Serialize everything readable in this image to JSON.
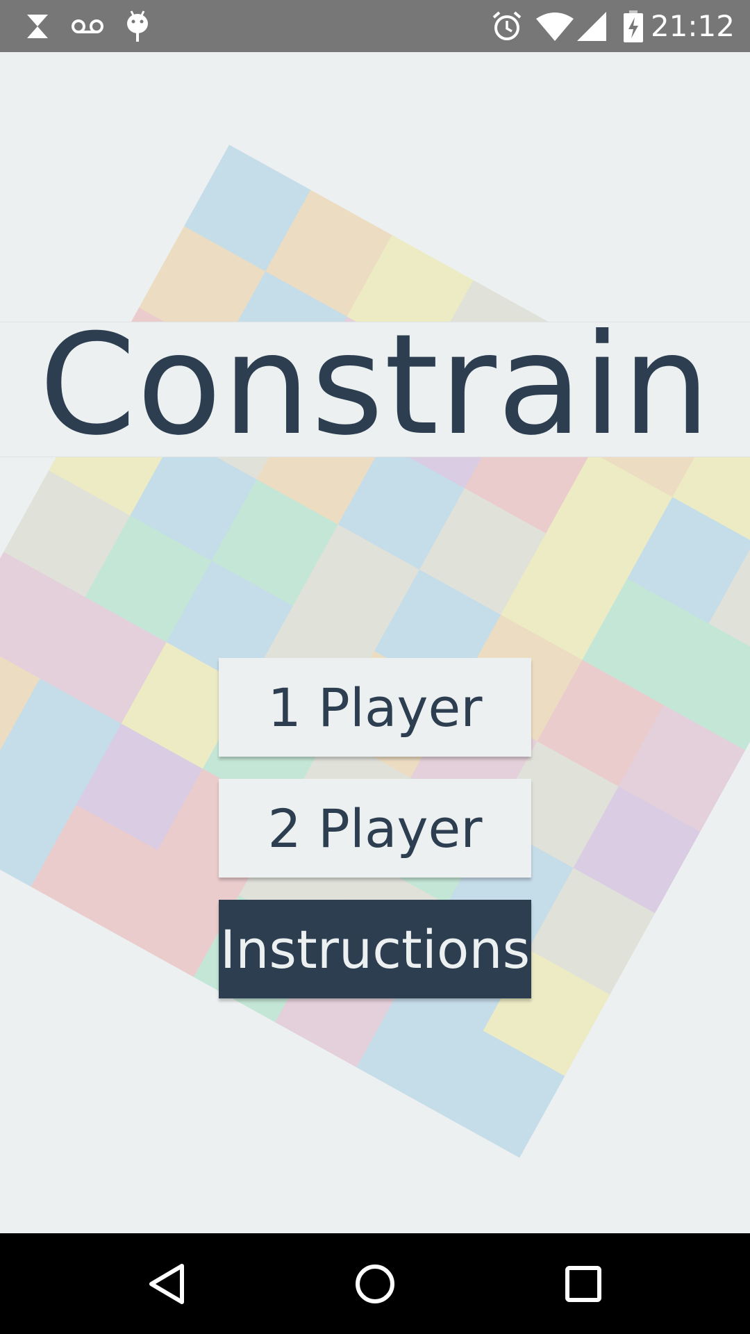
{
  "status_bar": {
    "time": "21:12",
    "left_icons": [
      "hourglass-icon",
      "voicemail-icon",
      "android-debug-icon"
    ],
    "right_icons": [
      "alarm-icon",
      "wifi-icon",
      "signal-icon",
      "battery-charging-icon"
    ]
  },
  "app": {
    "title": "Constrain"
  },
  "menu": {
    "one_player": "1 Player",
    "two_player": "2 Player",
    "instructions": "Instructions"
  },
  "board": {
    "tile_colors": [
      "#ecebc4",
      "#e0e1d9",
      "#e4d0da",
      "#c5dce9",
      "#ecdcc1",
      "#ebcccc",
      "#d9cce3",
      "#c4e6d6"
    ]
  },
  "nav_bar": {
    "icons": [
      "back-icon",
      "home-icon",
      "recents-icon"
    ]
  },
  "colors": {
    "background": "#ecf0f1",
    "primary": "#2c3e50",
    "status_bar": "#777777",
    "nav_bar": "#000000"
  }
}
